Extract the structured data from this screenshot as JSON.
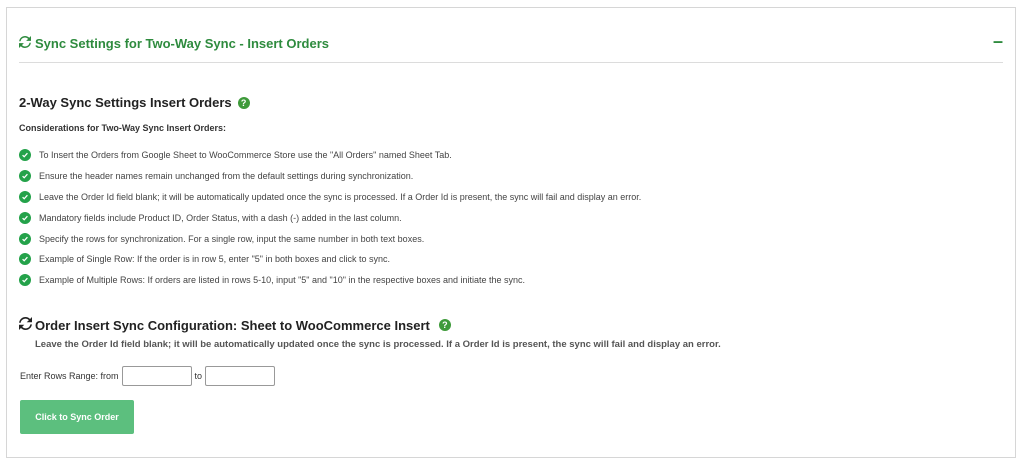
{
  "panel": {
    "title": "Sync Settings for Two-Way Sync - Insert Orders",
    "collapse_symbol": "–"
  },
  "section": {
    "heading": "2-Way Sync Settings Insert Orders",
    "considerations_label": "Considerations for Two-Way Sync Insert Orders:",
    "items": [
      "To Insert the Orders from Google Sheet to WooCommerce Store use the \"All Orders\" named Sheet Tab.",
      "Ensure the header names remain unchanged from the default settings during synchronization.",
      "Leave the Order Id field blank; it will be automatically updated once the sync is processed. If a Order Id is present, the sync will fail and display an error.",
      "Mandatory fields include Product ID, Order Status, with a dash (-) added in the last column.",
      "Specify the rows for synchronization. For a single row, input the same number in both text boxes.",
      "Example of Single Row: If the order is in row 5, enter \"5\" in both boxes and click to sync.",
      "Example of Multiple Rows: If orders are listed in rows 5-10, input \"5\" and \"10\" in the respective boxes and initiate the sync."
    ]
  },
  "config": {
    "heading": "Order Insert Sync Configuration: Sheet to WooCommerce Insert",
    "note": "Leave the Order Id field blank; it will be automatically updated once the sync is processed. If a Order Id is present, the sync will fail and display an error.",
    "range_label": "Enter Rows Range: from",
    "to_label": "to",
    "from_value": "",
    "to_value": "",
    "button_label": "Click to Sync Order"
  },
  "help_symbol": "?",
  "colors": {
    "accent_green": "#2e8b3e",
    "check_green": "#24a24a",
    "button_green": "#5cbf7e"
  },
  "icons": {
    "title": "sync-icon",
    "help": "help-icon",
    "check": "check-circle-icon",
    "collapse": "minus-icon"
  }
}
